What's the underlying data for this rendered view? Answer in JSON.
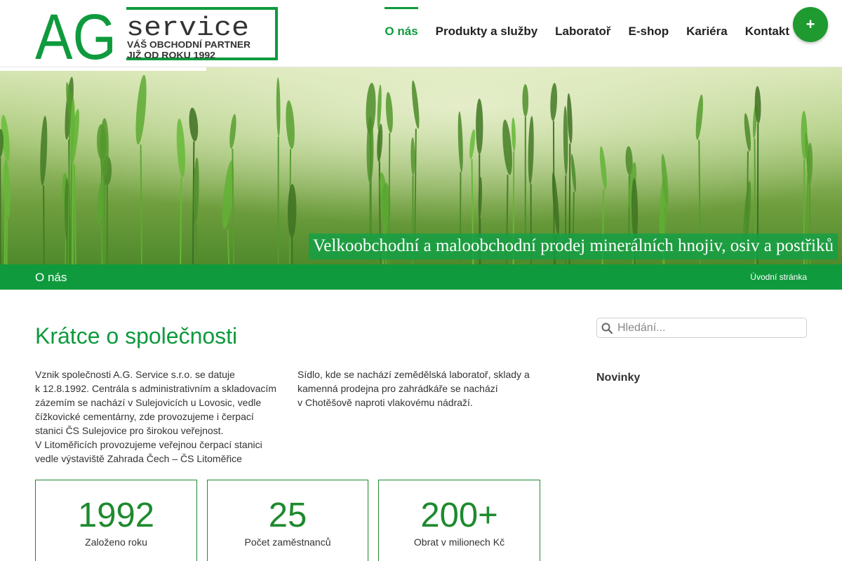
{
  "logo": {
    "letters": "AG",
    "word": "service",
    "tagline_1": "VÁŠ OBCHODNÍ PARTNER",
    "tagline_2": "JIŽ OD ROKU 1992"
  },
  "nav": {
    "items": [
      {
        "label": "O nás",
        "active": true
      },
      {
        "label": "Produkty a služby"
      },
      {
        "label": "Laboratoř"
      },
      {
        "label": "E-shop"
      },
      {
        "label": "Kariéra"
      },
      {
        "label": "Kontakt"
      }
    ],
    "plus_label": "+"
  },
  "hero": {
    "caption": "Velkoobchodní a maloobchodní prodej minerálních hnojiv, osiv a postřiků"
  },
  "title_bar": {
    "page_name": "O nás",
    "breadcrumb": "Úvodní stránka"
  },
  "main": {
    "heading": "Krátce o společnosti",
    "left_lines": [
      "Vznik společnosti A.G. Service s.r.o. se datuje",
      "k 12.8.1992. Centrála s administrativním a skladovacím",
      "zázemím se nachází v Sulejovicích u Lovosic, vedle",
      "čížkovické cementárny, zde provozujeme i čerpací",
      "stanici ČS Sulejovice pro širokou veřejnost.",
      "V Litoměřicích provozujeme veřejnou čerpací stanici",
      "vedle výstaviště Zahrada Čech – ČS Litoměřice"
    ],
    "right_lines": [
      "Sídlo, kde se nachází zemědělská laboratoř, sklady a",
      "kamenná prodejna pro zahrádkáře se nachází",
      "v Chotěšově naproti vlakovému nádraží."
    ],
    "stats": [
      {
        "value": "1992",
        "label": "Založeno roku"
      },
      {
        "value": "25",
        "label": "Počet zaměstnanců"
      },
      {
        "value": "200+",
        "label": "Obrat v milionech Kč"
      }
    ]
  },
  "sidebar": {
    "search_placeholder": "Hledání...",
    "news_title": "Novinky"
  },
  "colors": {
    "brand_green": "#0f9a3d",
    "stat_green": "#1e8a2e"
  }
}
